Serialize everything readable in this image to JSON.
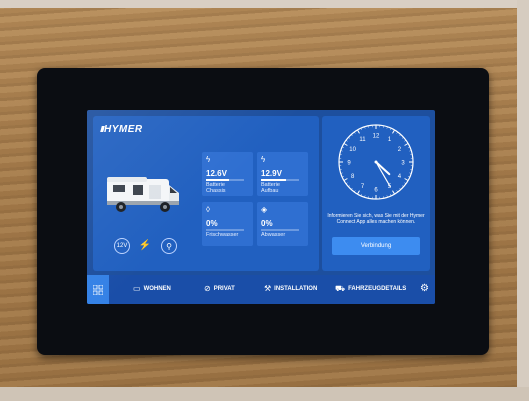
{
  "brand": "HYMER",
  "status_icons": {
    "battery_12v": "12V"
  },
  "tiles": [
    {
      "icon": "lightning-icon",
      "value": "12.6V",
      "label_line1": "Batterie",
      "label_line2": "Chassis",
      "level": 0.6
    },
    {
      "icon": "lightning-icon",
      "value": "12.9V",
      "label_line1": "Batterie",
      "label_line2": "Aufbau",
      "level": 0.65
    },
    {
      "icon": "water-drop-icon",
      "value": "0%",
      "label_line1": "Frischwasser",
      "label_line2": "",
      "level": 0
    },
    {
      "icon": "waste-drop-icon",
      "value": "0%",
      "label_line1": "Abwasser",
      "label_line2": "",
      "level": 0
    }
  ],
  "clock": {
    "numerals": [
      "12",
      "1",
      "2",
      "3",
      "4",
      "5",
      "6",
      "7",
      "8",
      "9",
      "10",
      "11"
    ],
    "time": {
      "hour": 4,
      "minute": 25
    }
  },
  "info_text": "Informieren Sie sich, was Sie mit der Hymer Connect App alles machen können.",
  "connect_button": "Verbindung",
  "nav": {
    "home": "home-grid-icon",
    "items": [
      {
        "label": "WOHNEN",
        "icon": "living-icon"
      },
      {
        "label": "PRIVAT",
        "icon": "private-icon"
      },
      {
        "label": "INSTALLATION",
        "icon": "installation-icon"
      },
      {
        "label": "FAHRZEUGDETAILS",
        "icon": "vehicle-icon"
      }
    ],
    "settings": "gear-icon"
  },
  "colors": {
    "screen_bg": "#1d4f9e",
    "panel": "#2160c0",
    "tile": "#2f6fd1",
    "accent_button": "#3d8cf0",
    "home_active": "#3481e6"
  }
}
